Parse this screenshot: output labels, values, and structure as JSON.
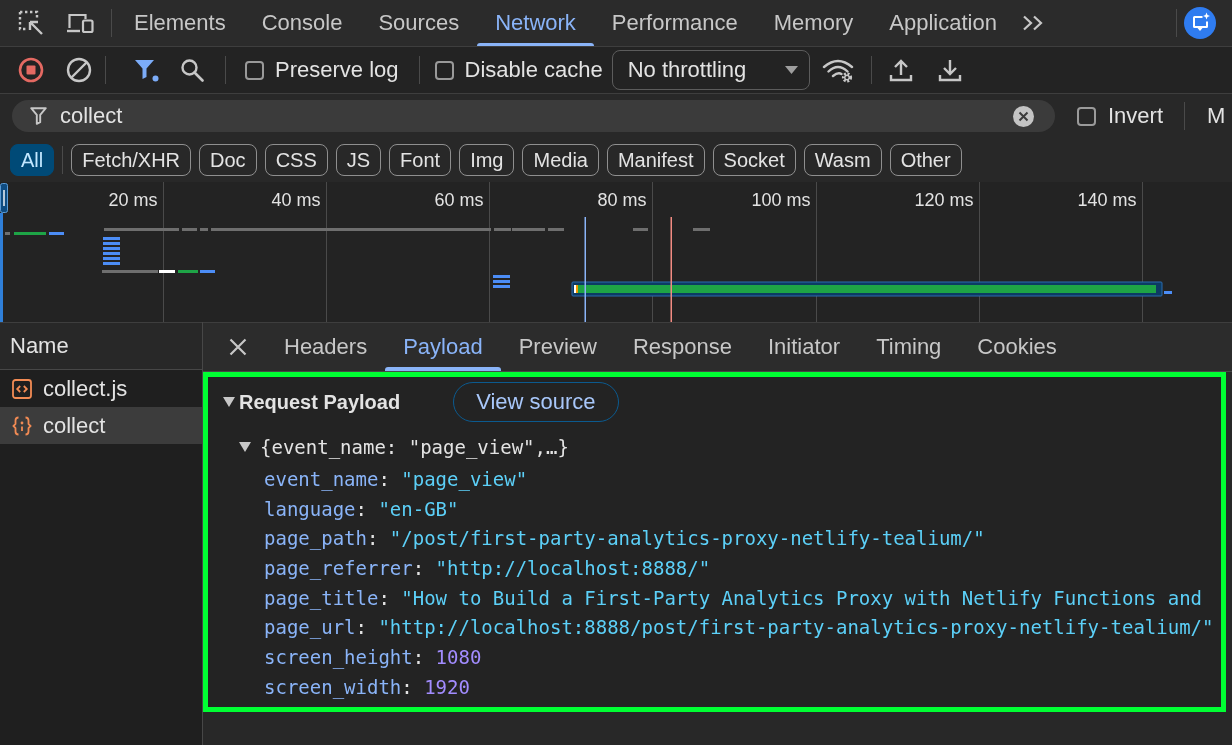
{
  "main_tabs": [
    {
      "label": "Elements",
      "selected": false
    },
    {
      "label": "Console",
      "selected": false
    },
    {
      "label": "Sources",
      "selected": false
    },
    {
      "label": "Network",
      "selected": true
    },
    {
      "label": "Performance",
      "selected": false
    },
    {
      "label": "Memory",
      "selected": false
    },
    {
      "label": "Application",
      "selected": false
    }
  ],
  "toolbar": {
    "preserve_log": {
      "label": "Preserve log",
      "checked": false
    },
    "disable_cache": {
      "label": "Disable cache",
      "checked": false
    },
    "throttling": {
      "value": "No throttling"
    }
  },
  "filter_bar": {
    "query": "collect",
    "invert": {
      "label": "Invert",
      "checked": false
    },
    "cut_off_label": "M"
  },
  "type_filters": [
    {
      "label": "All",
      "selected": true
    },
    {
      "label": "Fetch/XHR",
      "selected": false
    },
    {
      "label": "Doc",
      "selected": false
    },
    {
      "label": "CSS",
      "selected": false
    },
    {
      "label": "JS",
      "selected": false
    },
    {
      "label": "Font",
      "selected": false
    },
    {
      "label": "Img",
      "selected": false
    },
    {
      "label": "Media",
      "selected": false
    },
    {
      "label": "Manifest",
      "selected": false
    },
    {
      "label": "Socket",
      "selected": false
    },
    {
      "label": "Wasm",
      "selected": false
    },
    {
      "label": "Other",
      "selected": false
    }
  ],
  "timeline": {
    "ticks": [
      "20 ms",
      "40 ms",
      "60 ms",
      "80 ms",
      "100 ms",
      "120 ms",
      "140 ms"
    ]
  },
  "requests": {
    "column": "Name",
    "rows": [
      {
        "name": "collect.js",
        "kind": "script",
        "selected": false
      },
      {
        "name": "collect",
        "kind": "fetch",
        "selected": true
      }
    ]
  },
  "detail_tabs": [
    {
      "label": "Headers",
      "selected": false
    },
    {
      "label": "Payload",
      "selected": true
    },
    {
      "label": "Preview",
      "selected": false
    },
    {
      "label": "Response",
      "selected": false
    },
    {
      "label": "Initiator",
      "selected": false
    },
    {
      "label": "Timing",
      "selected": false
    },
    {
      "label": "Cookies",
      "selected": false
    }
  ],
  "payload": {
    "highlighted": true,
    "title": "Request Payload",
    "expanded": true,
    "view_source": "View source",
    "object": {
      "summary": "{event_name: \"page_view\",…}",
      "expanded": true,
      "properties": [
        {
          "key": "event_name",
          "colon": ":",
          "value": "\"page_view\"",
          "kind": "string"
        },
        {
          "key": "language",
          "colon": ":",
          "value": "\"en-GB\"",
          "kind": "string"
        },
        {
          "key": "page_path",
          "colon": ":",
          "value": "\"/post/first-party-analytics-proxy-netlify-tealium/\"",
          "kind": "string"
        },
        {
          "key": "page_referrer",
          "colon": ":",
          "value": "\"http://localhost:8888/\"",
          "kind": "string"
        },
        {
          "key": "page_title",
          "colon": ":",
          "value": "\"How to Build a First-Party Analytics Proxy with Netlify Functions and",
          "kind": "string"
        },
        {
          "key": "page_url",
          "colon": ":",
          "value": "\"http://localhost:8888/post/first-party-analytics-proxy-netlify-tealium/\"",
          "kind": "string"
        },
        {
          "key": "screen_height",
          "colon": ":",
          "value": "1080",
          "kind": "number"
        },
        {
          "key": "screen_width",
          "colon": ":",
          "value": "1920",
          "kind": "number"
        }
      ]
    }
  }
}
